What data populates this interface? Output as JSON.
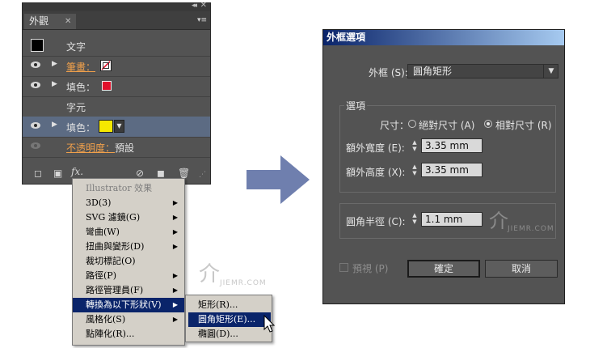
{
  "appearance_panel": {
    "tab_title": "外觀",
    "collapse_glyph": "◂◂",
    "close_glyph": "✕",
    "menu_glyph": "▾≡",
    "object_label": "文字",
    "rows": [
      {
        "label": "筆畫：",
        "type": "stroke",
        "visible": true
      },
      {
        "label": "填色：",
        "type": "fill",
        "visible": true,
        "color": "#e0102a"
      },
      {
        "label": "字元",
        "type": "header"
      },
      {
        "label": "填色：",
        "type": "fill",
        "visible": true,
        "selected": true,
        "color": "#f5e800"
      },
      {
        "label": "不透明度：",
        "value": "預設",
        "type": "opacity",
        "visible": false
      }
    ],
    "fx_label": "fx."
  },
  "effect_menu": {
    "header": "Illustrator 效果",
    "items": [
      {
        "label": "3D(3)",
        "submenu": true
      },
      {
        "label": "SVG 濾鏡(G)",
        "submenu": true
      },
      {
        "label": "彎曲(W)",
        "submenu": true
      },
      {
        "label": "扭曲與變形(D)",
        "submenu": true
      },
      {
        "label": "裁切標記(O)",
        "submenu": false
      },
      {
        "label": "路徑(P)",
        "submenu": true
      },
      {
        "label": "路徑管理員(F)",
        "submenu": true
      },
      {
        "label": "轉換為以下形狀(V)",
        "submenu": true,
        "highlighted": true
      },
      {
        "label": "風格化(S)",
        "submenu": true
      },
      {
        "label": "點陣化(R)...",
        "submenu": false
      }
    ],
    "submenu_items": [
      {
        "label": "矩形(R)..."
      },
      {
        "label": "圓角矩形(E)...",
        "highlighted": true
      },
      {
        "label": "橢圓(D)..."
      }
    ]
  },
  "dialog": {
    "title": "外框選項",
    "shape_label": "外框 (S):",
    "shape_value": "圓角矩形",
    "options_group": "選項",
    "size_label": "尺寸：",
    "radio_absolute": "絕對尺寸 (A)",
    "radio_relative": "相對尺寸 (R)",
    "radio_selected": "relative",
    "extra_width_label": "額外寬度 (E):",
    "extra_width_value": "3.35 mm",
    "extra_height_label": "額外高度 (X):",
    "extra_height_value": "3.35 mm",
    "corner_radius_label": "圓角半徑 (C):",
    "corner_radius_value": "1.1 mm",
    "preview_label": "預視 (P)",
    "ok_label": "確定",
    "cancel_label": "取消"
  },
  "watermark": {
    "text": "JIEMR.COM"
  },
  "colors": {
    "highlight": "#0a246a",
    "link": "#f0a04b",
    "arrow": "#6f7fae"
  }
}
